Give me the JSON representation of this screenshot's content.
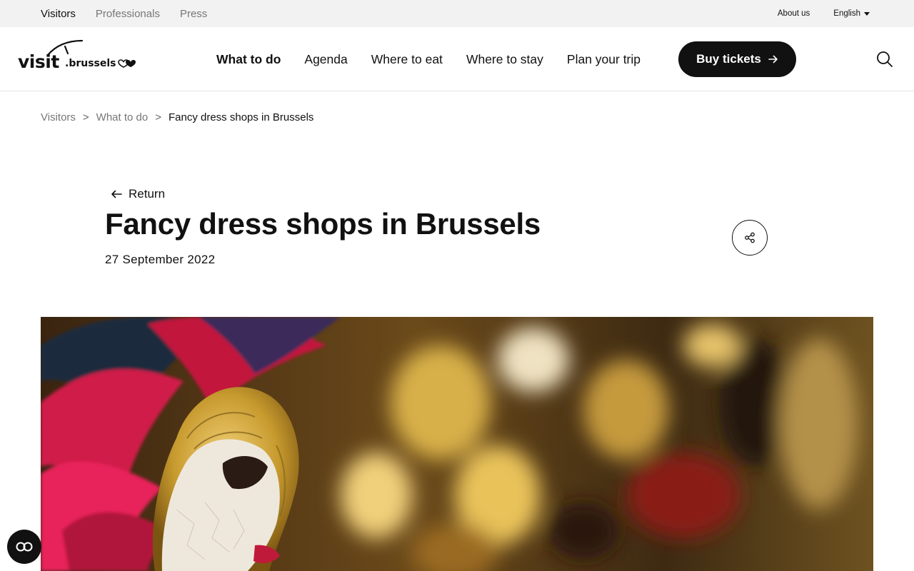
{
  "topbar": {
    "audiences": [
      "Visitors",
      "Professionals",
      "Press"
    ],
    "about": "About us",
    "language": "English"
  },
  "header": {
    "logo": {
      "word1": "visit",
      "word2": ".brussels"
    },
    "nav": [
      "What to do",
      "Agenda",
      "Where to eat",
      "Where to stay",
      "Plan your trip"
    ],
    "buy_label": "Buy tickets"
  },
  "breadcrumb": {
    "items": [
      "Visitors",
      "What to do"
    ],
    "current": "Fancy dress shops in Brussels"
  },
  "article": {
    "return_label": "Return",
    "title": "Fancy dress shops in Brussels",
    "date": "27 September 2022"
  },
  "colors": {
    "black": "#111111",
    "topbar_bg": "#f2f2f2",
    "muted_text": "#777777"
  },
  "icons": {
    "search": "search-icon",
    "share": "share-icon",
    "arrow_left": "arrow-left-icon",
    "arrow_right": "arrow-right-icon",
    "accessibility": "accessibility-icon"
  }
}
